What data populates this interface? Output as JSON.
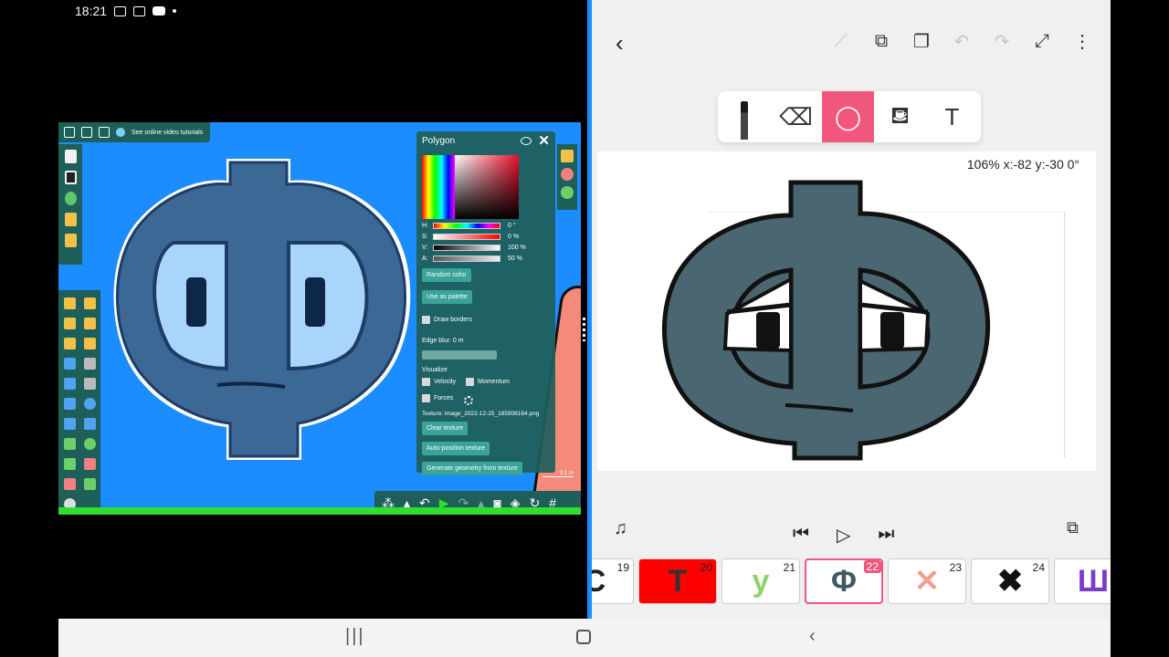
{
  "status_bar": {
    "time": "18:21"
  },
  "video": {
    "top_toolbar": {
      "tutorials_label": "See online video tutorials"
    },
    "polygon_panel": {
      "title": "Polygon",
      "h_label": "H:",
      "h_value": "0 °",
      "s_label": "S:",
      "s_value": "0 %",
      "v_label": "V:",
      "v_value": "100 %",
      "a_label": "A:",
      "a_value": "50 %",
      "random_color": "Random color",
      "use_as_palette": "Use as palette",
      "draw_borders": "Draw borders",
      "edge_blur": "Edge blur: 0 m",
      "visualize": "Visualize",
      "velocity": "Velocity",
      "momentum": "Momentum",
      "forces": "Forces",
      "texture": "Texture: image_2022-12-25_185908164.png",
      "clear_texture": "Clear texture",
      "auto_position_texture": "Auto-position texture",
      "generate_geometry": "Generate geometry from texture"
    },
    "scale_label": "0.1 m",
    "colors": {
      "background": "#1b8dff",
      "panel": "#1e5f5a",
      "ground": "#2ee02a",
      "character": "#3c6896"
    }
  },
  "drawing_app": {
    "toolbar_icons": [
      "ruler-icon",
      "copy-frame-icon",
      "duplicate-icon",
      "undo-icon",
      "redo-icon",
      "expand-icon",
      "more-icon"
    ],
    "tools": [
      "pen-tool",
      "eraser-tool",
      "lasso-tool",
      "fill-tool",
      "text-tool"
    ],
    "active_tool": "lasso-tool",
    "text_tool_glyph": "T",
    "canvas_info": "106% x:-82 y:-30 0°",
    "frames": [
      {
        "number": "19",
        "thumb": "C",
        "bg": "#ffffff",
        "fg": "#222222"
      },
      {
        "number": "20",
        "thumb": "T",
        "bg": "#ff0000",
        "fg": "#333333"
      },
      {
        "number": "21",
        "thumb": "y",
        "bg": "#ffffff",
        "fg": "#8fd16a"
      },
      {
        "number": "22",
        "thumb": "Φ",
        "bg": "#ffffff",
        "fg": "#3d5966"
      },
      {
        "number": "23",
        "thumb": "✕",
        "bg": "#ffffff",
        "fg": "#f0a090"
      },
      {
        "number": "24",
        "thumb": "✖",
        "bg": "#ffffff",
        "fg": "#111111"
      },
      {
        "number": "",
        "thumb": "Ш",
        "bg": "#ffffff",
        "fg": "#7a3cc8"
      }
    ],
    "active_frame": "22",
    "colors": {
      "accent": "#f1567d",
      "character": "#4a6670"
    }
  }
}
